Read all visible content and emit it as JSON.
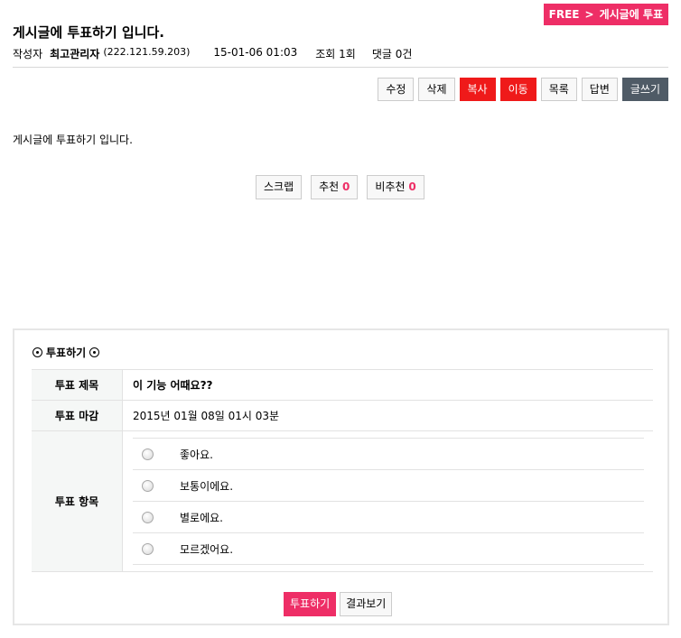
{
  "breadcrumb": {
    "category": "FREE",
    "separator": ">",
    "post": "게시글에 투표"
  },
  "post": {
    "title": "게시글에 투표하기 입니다.",
    "author_label": "작성자",
    "author": "최고관리자",
    "ip": "(222.121.59.203)",
    "datetime": "15-01-06 01:03",
    "views": "조회 1회",
    "comments": "댓글 0건",
    "content": "게시글에 투표하기 입니다."
  },
  "toolbar": {
    "edit": "수정",
    "delete": "삭제",
    "copy": "복사",
    "move": "이동",
    "list": "목록",
    "reply": "답변",
    "write": "글쓰기"
  },
  "actions": {
    "scrap": "스크랩",
    "recommend": "추천",
    "recommend_count": "0",
    "not_recommend": "비추천",
    "not_recommend_count": "0"
  },
  "poll": {
    "heading": "투표하기",
    "subject_label": "투표 제목",
    "subject": "이 기능 어때요??",
    "deadline_label": "투표 마감",
    "deadline": "2015년 01월 08일 01시 03분",
    "items_label": "투표 항목",
    "options": [
      "좋아요.",
      "보통이에요.",
      "별로에요.",
      "모르겠어요."
    ],
    "vote_button": "투표하기",
    "results_button": "결과보기"
  },
  "colors": {
    "accent": "#ee2e66",
    "red": "#ef1a1a",
    "dark": "#4f5b66"
  }
}
